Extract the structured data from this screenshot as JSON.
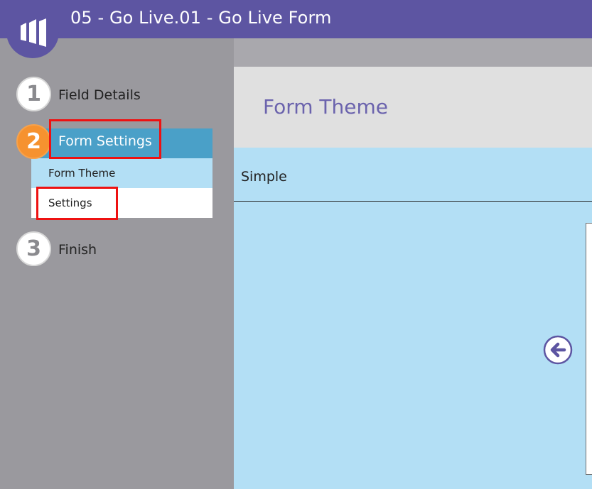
{
  "header": {
    "title": "05 - Go Live.01 - Go Live Form",
    "logo_icon": "marketo-logo-icon"
  },
  "sidebar": {
    "steps": [
      {
        "number": "1",
        "label": "Field Details"
      },
      {
        "number": "2",
        "label": "Form Settings"
      },
      {
        "number": "3",
        "label": "Finish"
      }
    ],
    "subitems": [
      {
        "label": "Form Theme"
      },
      {
        "label": "Settings"
      }
    ]
  },
  "main": {
    "panel_title": "Form Theme",
    "option_label": "Simple",
    "back_icon": "arrow-left-circle-icon"
  },
  "colors": {
    "header_bg": "#5d55a2",
    "active_step": "#f6922f",
    "active_bar": "#4aa0c8",
    "light_blue": "#b3dff5",
    "highlight": "#ee1111"
  }
}
